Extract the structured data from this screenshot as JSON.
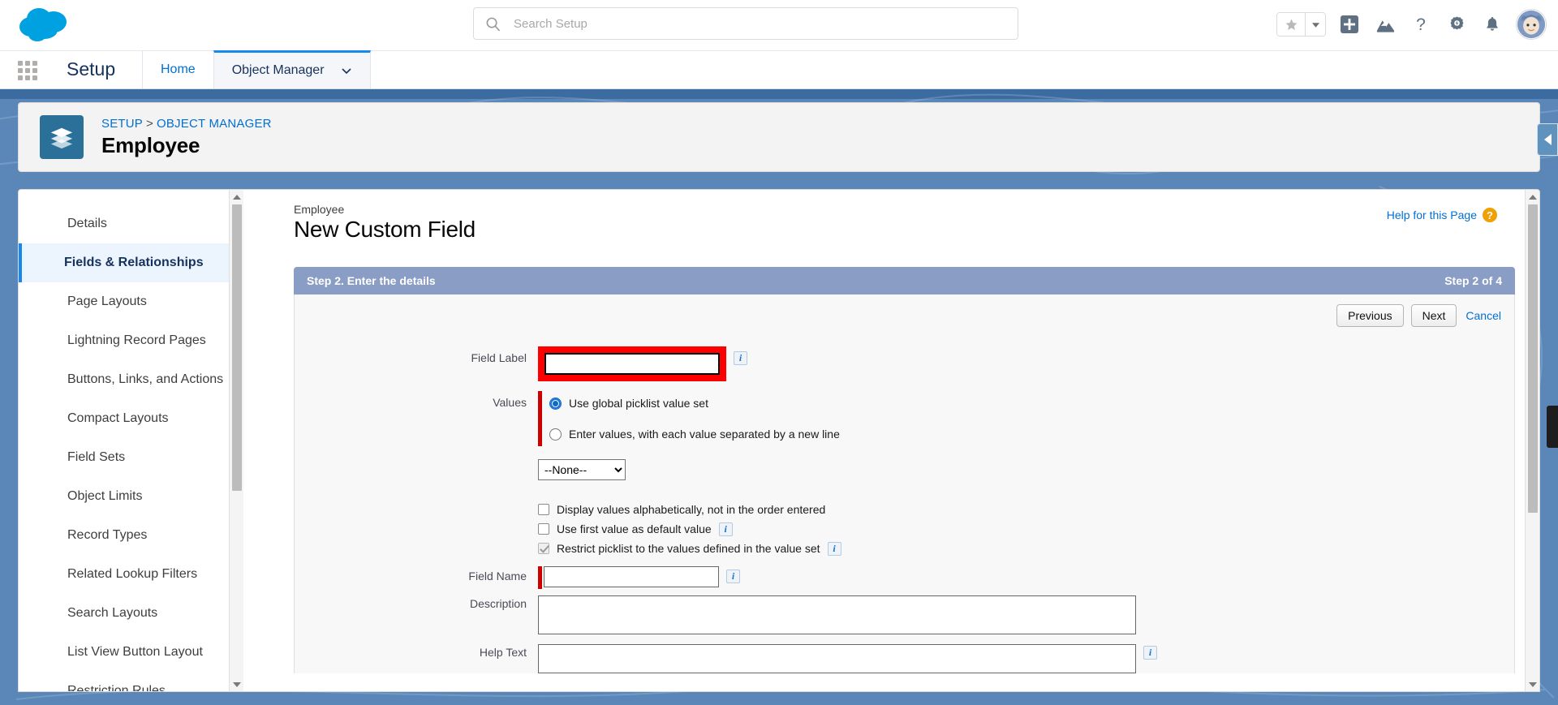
{
  "header": {
    "logo_alt": "salesforce-cloud-logo",
    "search": {
      "placeholder": "Search Setup",
      "value": ""
    },
    "icons": [
      {
        "name": "favorites-star-icon",
        "glyph": "star"
      },
      {
        "name": "favorites-dropdown-icon",
        "glyph": "caret-down"
      },
      {
        "name": "global-actions-add-icon",
        "glyph": "plus-square"
      },
      {
        "name": "trailhead-icon",
        "glyph": "mountain"
      },
      {
        "name": "help-icon",
        "glyph": "question"
      },
      {
        "name": "setup-gear-icon",
        "glyph": "gear"
      },
      {
        "name": "notifications-bell-icon",
        "glyph": "bell"
      },
      {
        "name": "user-avatar",
        "glyph": "avatar"
      }
    ]
  },
  "setup_bar": {
    "app_launcher": "app-launcher-waffle",
    "title": "Setup",
    "tabs": [
      {
        "label": "Home",
        "active": false,
        "has_caret": false
      },
      {
        "label": "Object Manager",
        "active": true,
        "has_caret": true
      }
    ]
  },
  "object_header": {
    "breadcrumb": {
      "items": [
        "SETUP",
        "OBJECT MANAGER"
      ],
      "separator": ">"
    },
    "title": "Employee",
    "icon": "layers-icon"
  },
  "sidebar": {
    "items": [
      {
        "label": "Details",
        "active": false
      },
      {
        "label": "Fields & Relationships",
        "active": true
      },
      {
        "label": "Page Layouts",
        "active": false
      },
      {
        "label": "Lightning Record Pages",
        "active": false
      },
      {
        "label": "Buttons, Links, and Actions",
        "active": false
      },
      {
        "label": "Compact Layouts",
        "active": false
      },
      {
        "label": "Field Sets",
        "active": false
      },
      {
        "label": "Object Limits",
        "active": false
      },
      {
        "label": "Record Types",
        "active": false
      },
      {
        "label": "Related Lookup Filters",
        "active": false
      },
      {
        "label": "Search Layouts",
        "active": false
      },
      {
        "label": "List View Button Layout",
        "active": false
      },
      {
        "label": "Restriction Rules",
        "active": false
      }
    ]
  },
  "main": {
    "eyebrow": "Employee",
    "title": "New Custom Field",
    "help_link": "Help for this Page",
    "help_icon_glyph": "?",
    "step": {
      "heading": "Step 2. Enter the details",
      "counter": "Step 2 of 4"
    },
    "buttons": {
      "previous": "Previous",
      "next": "Next",
      "cancel": "Cancel"
    },
    "form": {
      "field_label": {
        "label": "Field Label",
        "value": "",
        "info": "i",
        "highlighted": true
      },
      "values": {
        "label": "Values",
        "options": [
          {
            "label": "Use global picklist value set",
            "selected": true
          },
          {
            "label": "Enter values, with each value separated by a new line",
            "selected": false
          }
        ],
        "picklist": {
          "selected": "--None--",
          "options": [
            "--None--"
          ]
        },
        "checkboxes": [
          {
            "label": "Display values alphabetically, not in the order entered",
            "checked": false,
            "disabled": false,
            "info": false
          },
          {
            "label": "Use first value as default value",
            "checked": false,
            "disabled": false,
            "info": true
          },
          {
            "label": "Restrict picklist to the values defined in the value set",
            "checked": true,
            "disabled": true,
            "info": true
          }
        ]
      },
      "field_name": {
        "label": "Field Name",
        "value": "",
        "info": "i",
        "required": true
      },
      "description": {
        "label": "Description",
        "value": ""
      },
      "help_text": {
        "label": "Help Text",
        "value": "",
        "info": "i"
      }
    }
  },
  "colors": {
    "brand_blue": "#1589ee",
    "link_blue": "#0070d2",
    "backdrop_blue": "#5a87b8",
    "step_header": "#8a9dc4",
    "annotation_red": "#ff0000",
    "required_red": "#cc0000",
    "help_orange": "#f0a000"
  }
}
